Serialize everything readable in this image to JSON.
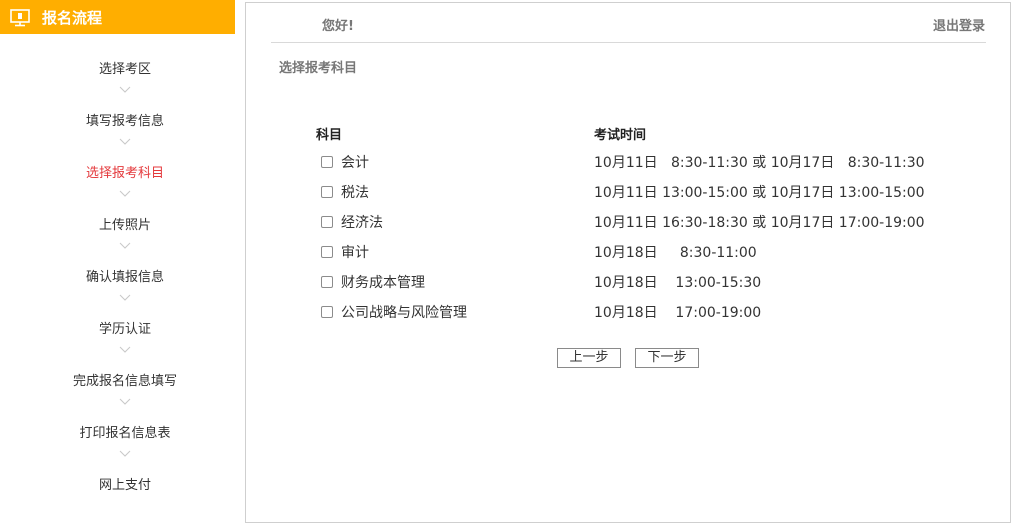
{
  "sidebar": {
    "title": "报名流程",
    "steps": [
      {
        "label": "选择考区",
        "active": false
      },
      {
        "label": "填写报考信息",
        "active": false
      },
      {
        "label": "选择报考科目",
        "active": true
      },
      {
        "label": "上传照片",
        "active": false
      },
      {
        "label": "确认填报信息",
        "active": false
      },
      {
        "label": "学历认证",
        "active": false
      },
      {
        "label": "完成报名信息填写",
        "active": false
      },
      {
        "label": "打印报名信息表",
        "active": false
      },
      {
        "label": "网上支付",
        "active": false
      }
    ]
  },
  "header": {
    "greeting": "您好!",
    "logout": "退出登录"
  },
  "main": {
    "section_title": "选择报考科目",
    "table": {
      "headers": [
        "科目",
        "考试时间"
      ],
      "rows": [
        {
          "subject": "会计",
          "time": "10月11日   8:30-11:30 或 10月17日   8:30-11:30",
          "checked": false
        },
        {
          "subject": "税法",
          "time": "10月11日 13:00-15:00 或 10月17日 13:00-15:00",
          "checked": false
        },
        {
          "subject": "经济法",
          "time": "10月11日 16:30-18:30 或 10月17日 17:00-19:00",
          "checked": false
        },
        {
          "subject": "审计",
          "time": "10月18日     8:30-11:00",
          "checked": false
        },
        {
          "subject": "财务成本管理",
          "time": "10月18日    13:00-15:30",
          "checked": false
        },
        {
          "subject": "公司战略与风险管理",
          "time": "10月18日    17:00-19:00",
          "checked": false
        }
      ]
    },
    "buttons": {
      "prev": "上一步",
      "next": "下一步"
    }
  },
  "colors": {
    "header_bg": "#ffae00",
    "active_step": "#e4393c",
    "muted_text": "#777777"
  },
  "icons": {
    "header": "monitor-icon",
    "step_separator": "chevron-down-icon"
  }
}
